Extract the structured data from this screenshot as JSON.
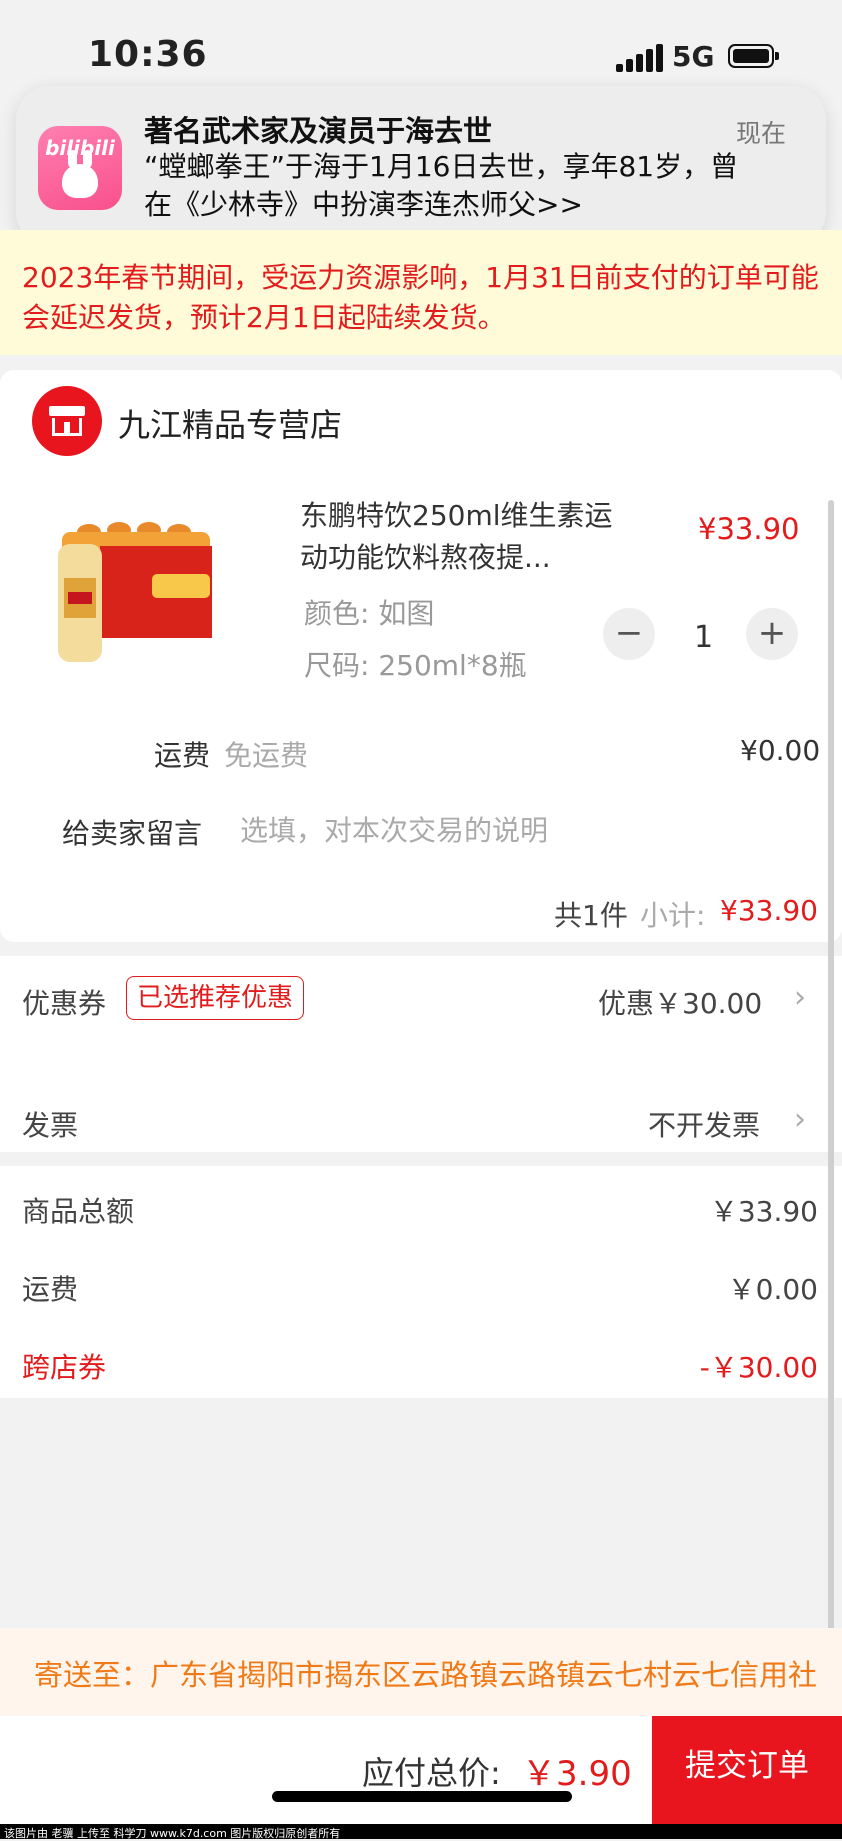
{
  "status_bar": {
    "time": "10:36",
    "network": "5G"
  },
  "notification": {
    "app": "bilibili",
    "title": "著名武术家及演员于海去世",
    "time": "现在",
    "body": "“螳螂拳王”于海于1月16日去世，享年81岁，曾在《少林寺》中扮演李连杰师父>>"
  },
  "notice": "2023年春节期间，受运力资源影响，1月31日前支付的订单可能会延迟发货，预计2月1日起陆续发货。",
  "store": {
    "name": "九江精品专营店",
    "icon": "store-icon",
    "product": {
      "title": "东鹏特饮250ml维生素运动功能饮料熬夜提...",
      "price": "¥33.90",
      "color": "颜色: 如图",
      "size": "尺码: 250ml*8瓶",
      "quantity": "1",
      "minus": "−",
      "plus": "+"
    },
    "shipping": {
      "label": "运费",
      "value": "免运费",
      "price": "¥0.00"
    },
    "message": {
      "label": "给卖家留言",
      "placeholder": "选填，对本次交易的说明"
    },
    "count": "共1件",
    "subtotal_label": "小计:",
    "subtotal_value": "¥33.90"
  },
  "coupon": {
    "label": "优惠券",
    "badge": "已选推荐优惠",
    "value": "优惠￥30.00"
  },
  "invoice": {
    "label": "发票",
    "value": "不开发票"
  },
  "totals": {
    "goods_label": "商品总额",
    "goods_value": "￥33.90",
    "shipping_label": "运费",
    "shipping_value": "￥0.00",
    "crossstore_label": "跨店券",
    "crossstore_value": "-￥30.00"
  },
  "address": "寄送至：广东省揭阳市揭东区云路镇云路镇云七村云七信用社",
  "bottom_bar": {
    "pay_label": "应付总价:",
    "pay_value": "￥3.90",
    "submit": "提交订单"
  },
  "footer": "该图片由 老骥 上传至 科学刀 www.k7d.com 图片版权归原创者所有",
  "colors": {
    "accent": "#e8141e",
    "notice_bg": "#fffbd9",
    "address_text": "#f07a18"
  }
}
